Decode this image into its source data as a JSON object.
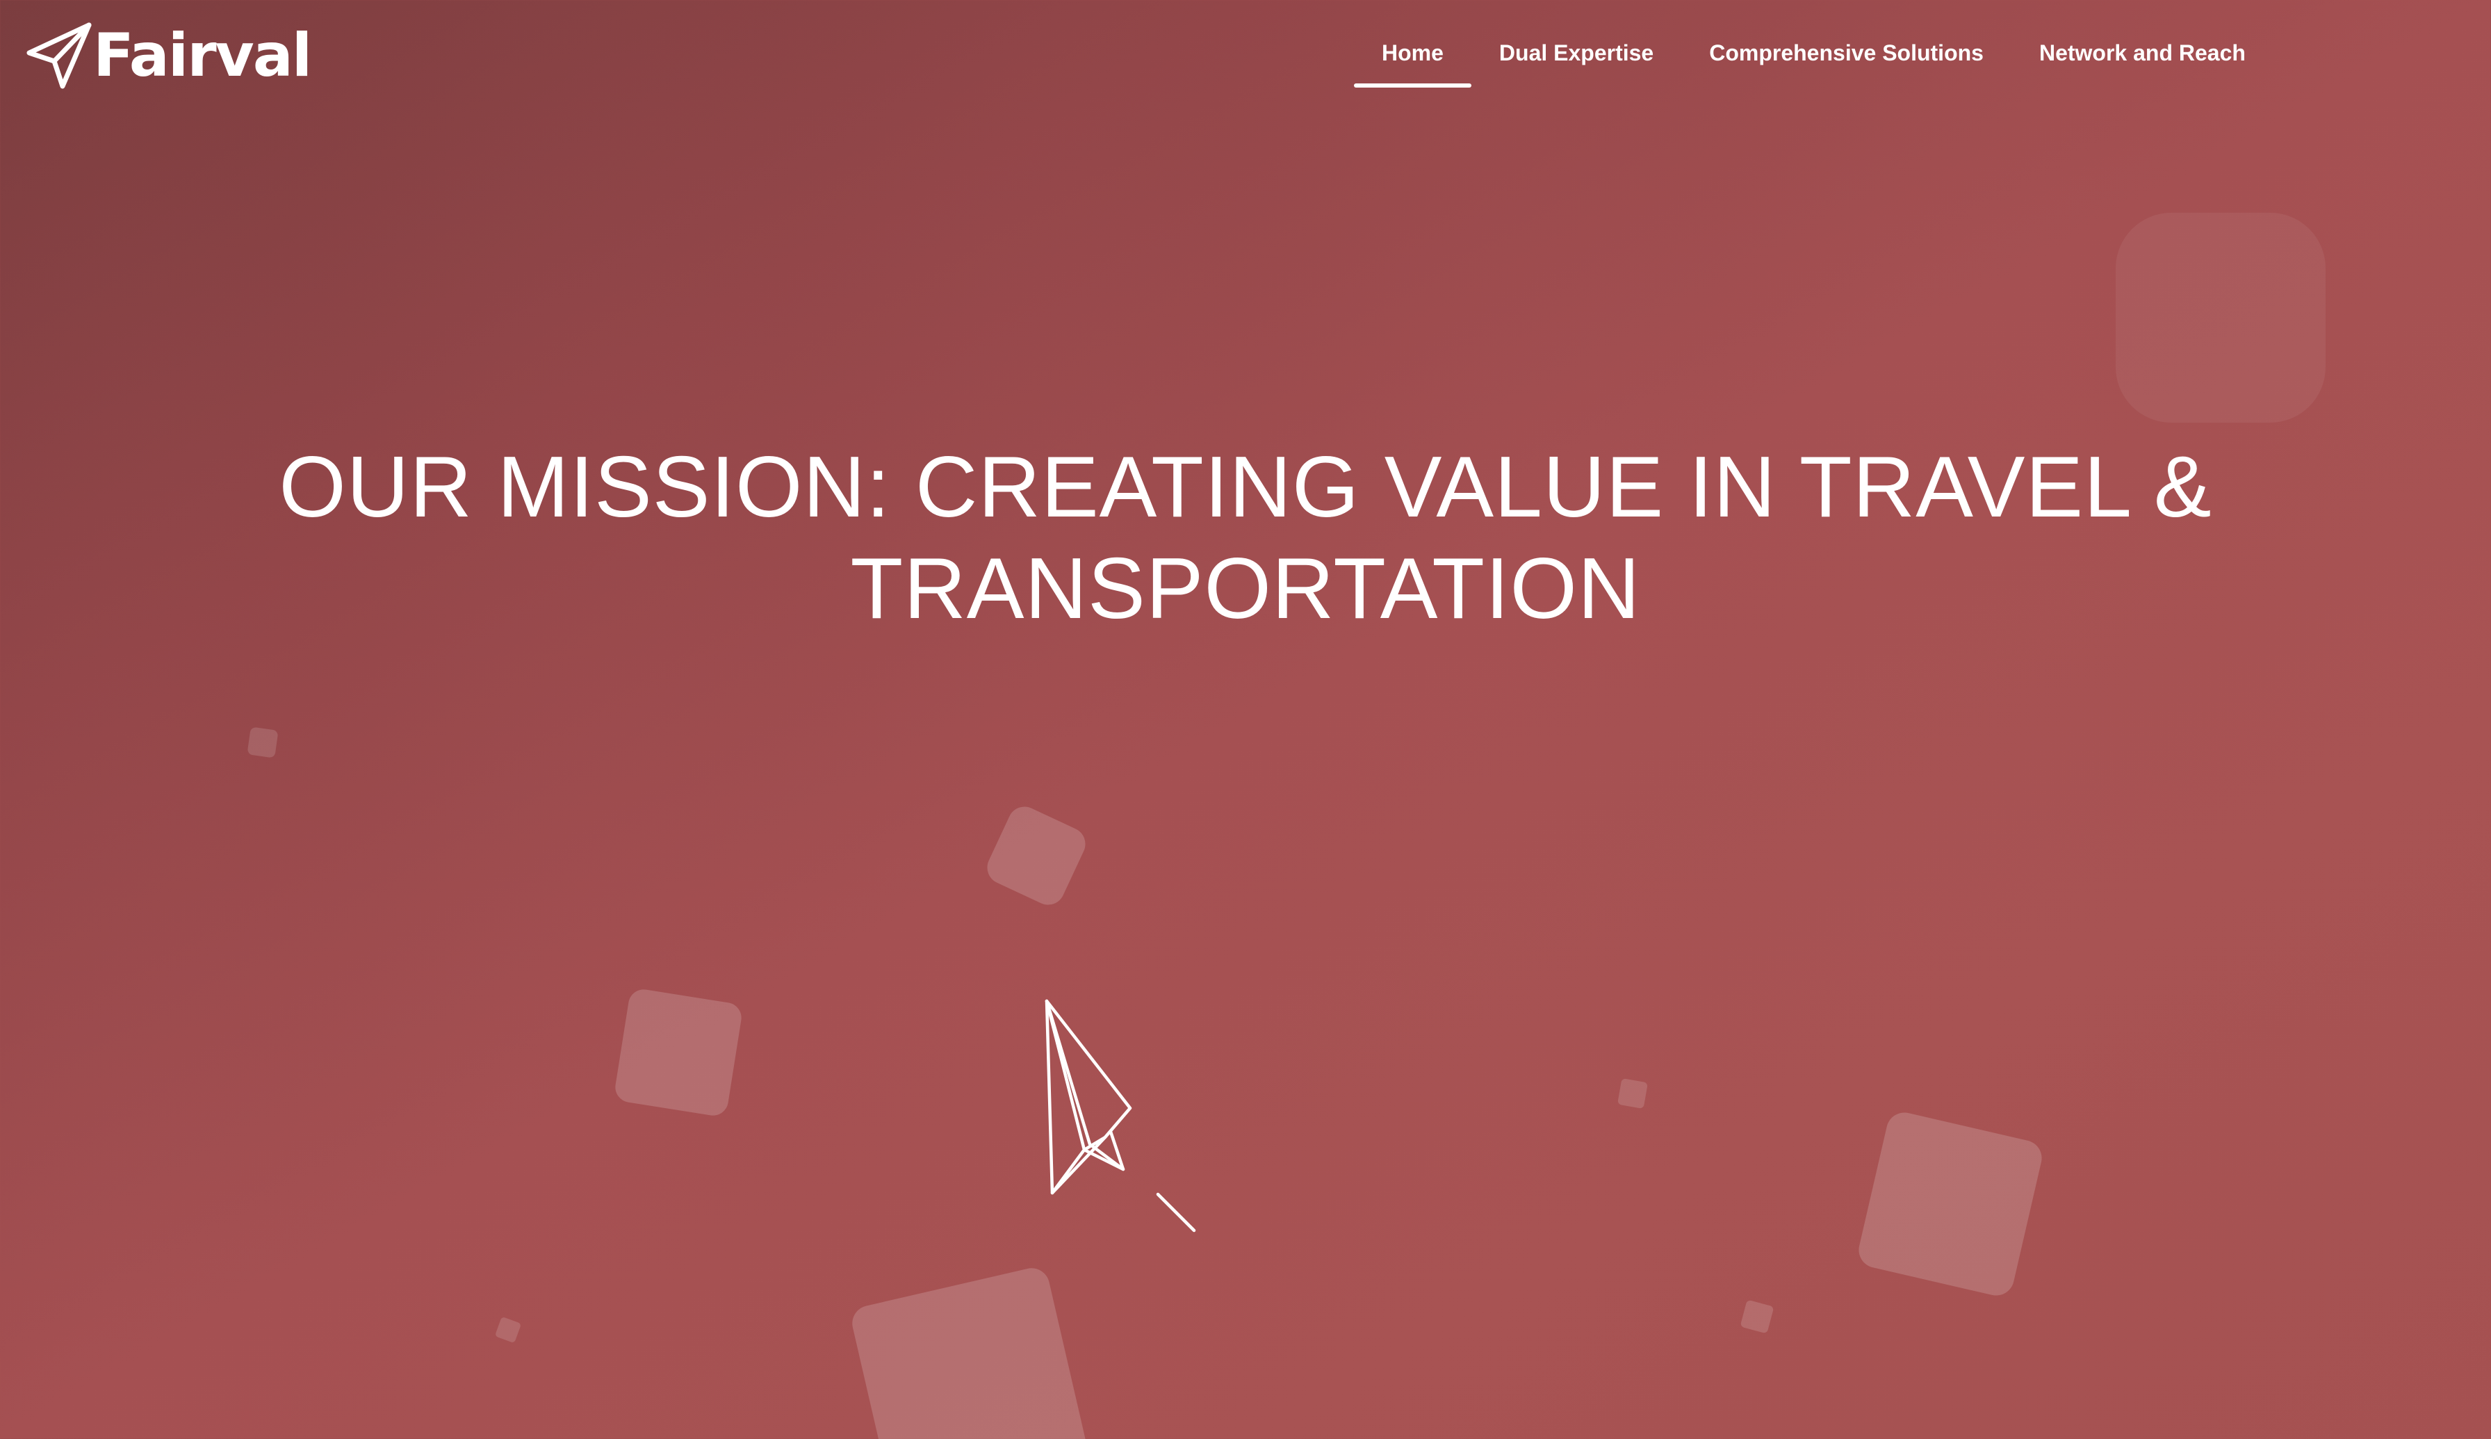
{
  "brand": {
    "name": "Fairval",
    "logo_icon": "paper-plane-icon"
  },
  "nav": {
    "items": [
      {
        "label": "Home",
        "active": true
      },
      {
        "label": "Dual Expertise",
        "active": false
      },
      {
        "label": "Comprehensive Solutions",
        "active": false
      },
      {
        "label": "Network and Reach",
        "active": false
      }
    ]
  },
  "hero": {
    "title_line1": "OUR MISSION: CREATING VALUE IN TRAVEL &",
    "title_line2": "TRANSPORTATION",
    "illustration": "paper-plane-icon"
  },
  "colors": {
    "background_start": "#7b3d3f",
    "background_end": "#a85353",
    "text": "#ffffff"
  }
}
